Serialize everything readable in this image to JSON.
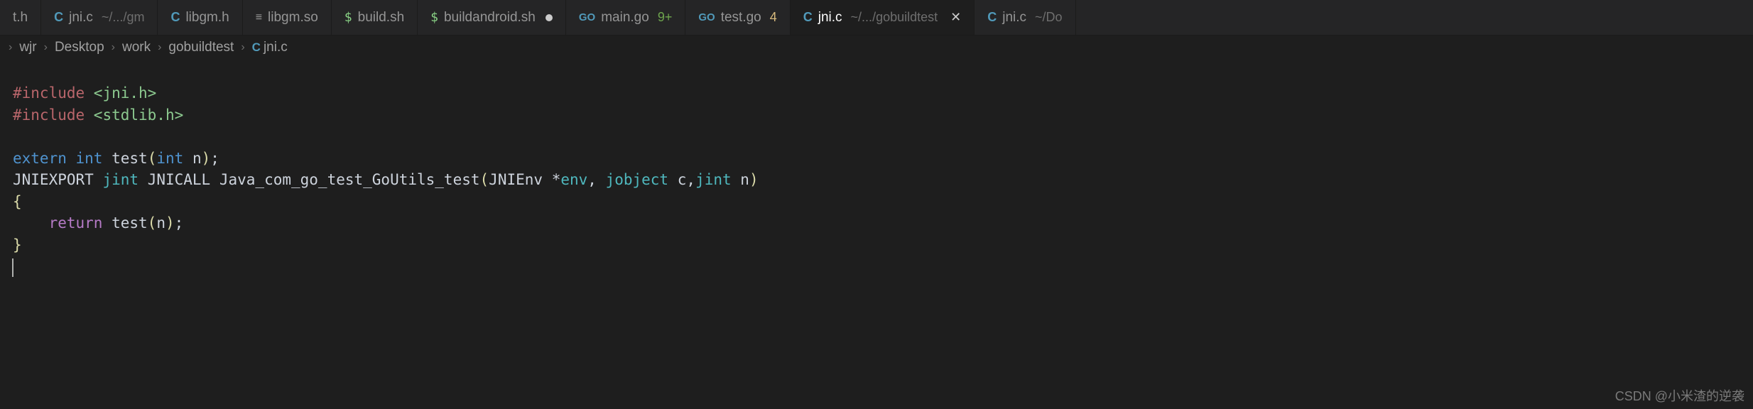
{
  "tabs": [
    {
      "icon": "",
      "label": "t.h",
      "sub": "",
      "badge": "",
      "dirty": false,
      "active": false
    },
    {
      "icon": "C",
      "label": "jni.c",
      "sub": "~/.../gm",
      "badge": "",
      "dirty": false,
      "active": false
    },
    {
      "icon": "C",
      "label": "libgm.h",
      "sub": "",
      "badge": "",
      "dirty": false,
      "active": false
    },
    {
      "icon": "list",
      "label": "libgm.so",
      "sub": "",
      "badge": "",
      "dirty": false,
      "active": false
    },
    {
      "icon": "term",
      "label": "build.sh",
      "sub": "",
      "badge": "",
      "dirty": false,
      "active": false
    },
    {
      "icon": "term",
      "label": "buildandroid.sh",
      "sub": "",
      "badge": "",
      "dirty": true,
      "active": false
    },
    {
      "icon": "go",
      "label": "main.go",
      "sub": "",
      "badge": "9+",
      "badgeClass": "g",
      "dirty": false,
      "active": false
    },
    {
      "icon": "go",
      "label": "test.go",
      "sub": "",
      "badge": "4",
      "badgeClass": "y",
      "dirty": false,
      "active": false
    },
    {
      "icon": "C",
      "label": "jni.c",
      "sub": "~/.../gobuildtest",
      "badge": "",
      "dirty": false,
      "active": true,
      "close": true
    },
    {
      "icon": "C",
      "label": "jni.c",
      "sub": "~/Do",
      "badge": "",
      "dirty": false,
      "active": false
    }
  ],
  "breadcrumb": [
    "wjr",
    "Desktop",
    "work",
    "gobuildtest",
    "jni.c"
  ],
  "breadcrumb_icon": "C",
  "code": {
    "inc1a": "#include",
    "inc1b": " <jni.h>",
    "inc2a": "#include",
    "inc2b": " <stdlib.h>",
    "blank": "",
    "extern_kw": "extern",
    "sp": " ",
    "int1": "int",
    "sp2": " ",
    "testfn": "test",
    "lp": "(",
    "int2": "int",
    "sp3": " ",
    "n1": "n",
    "rp": ")",
    "semi": ";",
    "l4a": "JNIEXPORT",
    "l4b": " ",
    "l4c": "jint",
    "l4d": " ",
    "l4e": "JNICALL",
    "l4f": " ",
    "l4g": "Java_com_go_test_GoUtils_test",
    "l4h": "(",
    "l4i": "JNIEnv ",
    "l4j": "*",
    "l4k": "env",
    "l4l": ", ",
    "l4m": "jobject",
    "l4n": " ",
    "l4o": "c",
    "l4p": ",",
    "l4q": "jint",
    "l4r": " ",
    "l4s": "n",
    "l4t": ")",
    "lb": "{",
    "indent": "    ",
    "ret": "return",
    "sp4": " ",
    "testcall": "test",
    "lp2": "(",
    "n2": "n",
    "rp2": ")",
    "semi2": ";",
    "rb": "}"
  },
  "watermark": "CSDN @小米渣的逆袭",
  "close_glyph": "✕"
}
